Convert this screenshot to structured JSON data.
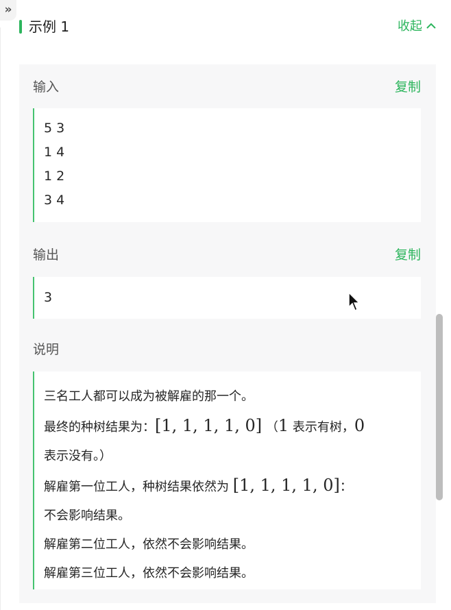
{
  "header": {
    "title": "示例 1",
    "collapse_label": "收起"
  },
  "input_section": {
    "label": "输入",
    "copy_label": "复制",
    "lines": [
      "5 3",
      "1 4",
      "1 2",
      "3 4"
    ]
  },
  "output_section": {
    "label": "输出",
    "copy_label": "复制",
    "lines": [
      "3"
    ]
  },
  "explanation_section": {
    "label": "说明",
    "line1": "三名工人都可以成为被解雇的那一个。",
    "line2_text": "最终的种树结果为：",
    "line2_math": "[1, 1, 1, 1, 0]",
    "line2_paren": "（",
    "line2_math_one": "1",
    "line2_mid": "表示有树，",
    "line2_math_zero": "0",
    "line3": "表示没有。）",
    "line4_text": "解雇第一位工人，种树结果依然为",
    "line4_math": "[1, 1, 1, 1, 0]",
    "line4_end": "：",
    "line5": "不会影响结果。",
    "line6": "解雇第二位工人，依然不会影响结果。",
    "line7": "解雇第三位工人，依然不会影响结果。"
  },
  "colors": {
    "accent": "#2db55d",
    "panel_bg": "#f7f7f8",
    "code_border": "#45c36f"
  },
  "icons": {
    "expand": "double-chevron-right-icon",
    "collapse": "chevron-up-icon",
    "cursor": "mouse-pointer-icon"
  }
}
